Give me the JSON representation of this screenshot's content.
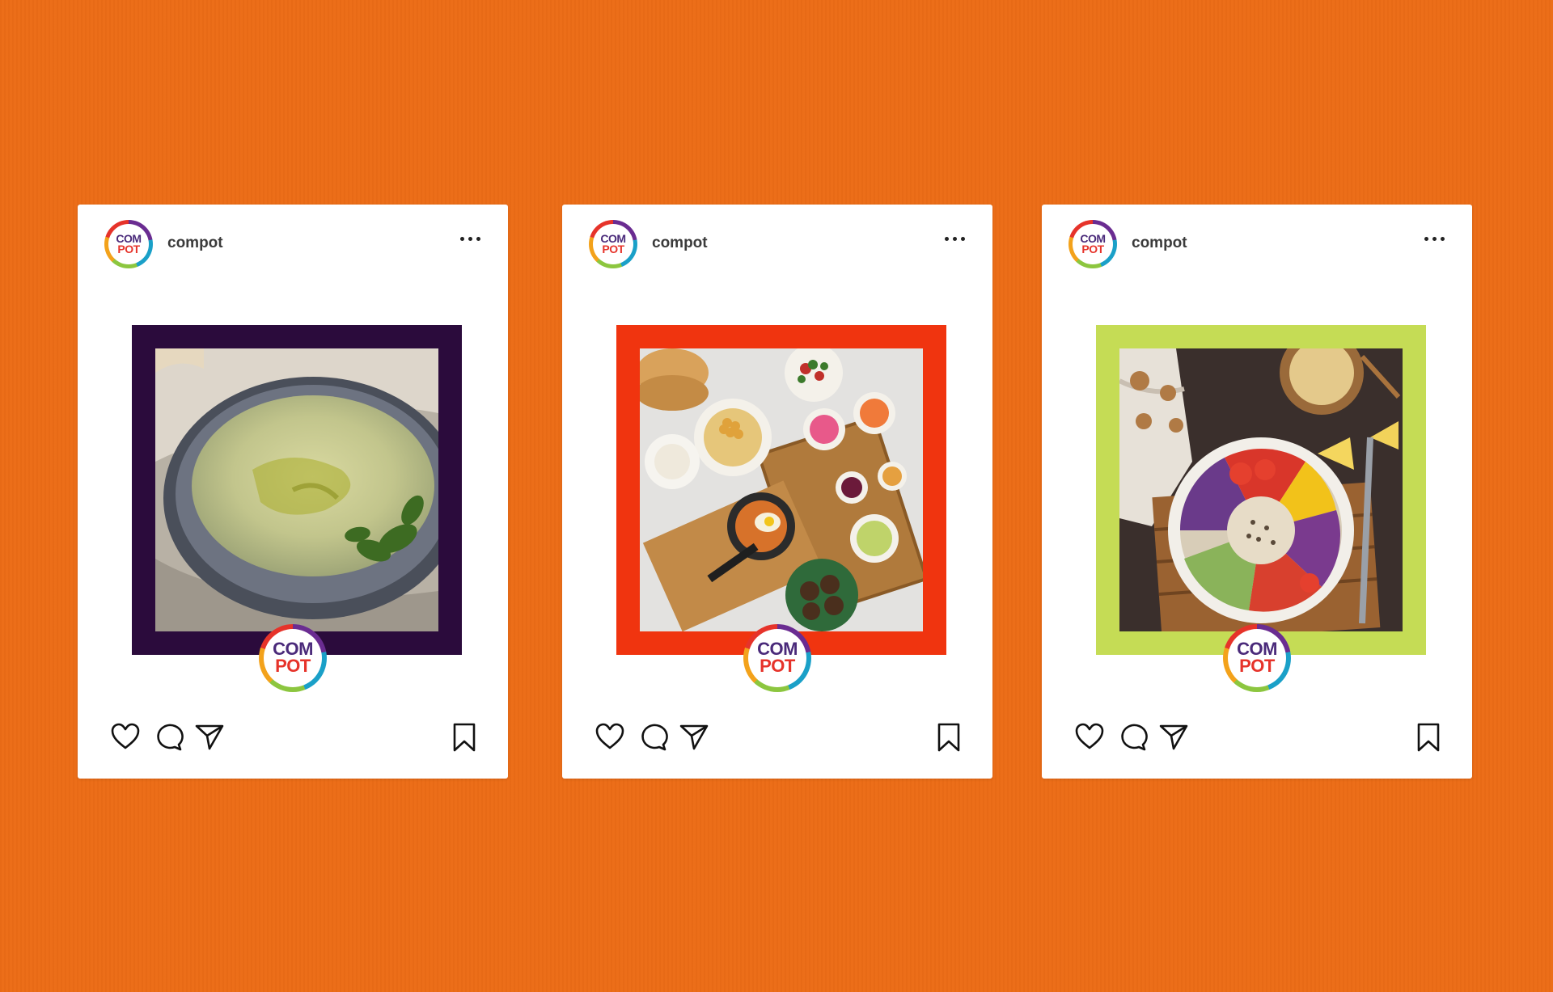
{
  "posts": [
    {
      "username": "compot",
      "logo_top": "COM",
      "logo_bottom": "POT",
      "frame_color": "#2b0b3c",
      "photo": "baba-ganoush-bowl"
    },
    {
      "username": "compot",
      "logo_top": "COM",
      "logo_bottom": "POT",
      "frame_color": "#f0340f",
      "photo": "mezze-table-spread"
    },
    {
      "username": "compot",
      "logo_top": "COM",
      "logo_bottom": "POT",
      "frame_color": "#c5dc55",
      "photo": "salad-bowl-on-board"
    }
  ],
  "icons": {
    "more": "more-horizontal-icon",
    "like": "heart-icon",
    "comment": "comment-icon",
    "share": "paper-plane-icon",
    "save": "bookmark-icon"
  },
  "colors": {
    "background": "#ec6c16",
    "card": "#ffffff",
    "brand_purple": "#4a2a7a",
    "brand_red": "#e6332a"
  }
}
